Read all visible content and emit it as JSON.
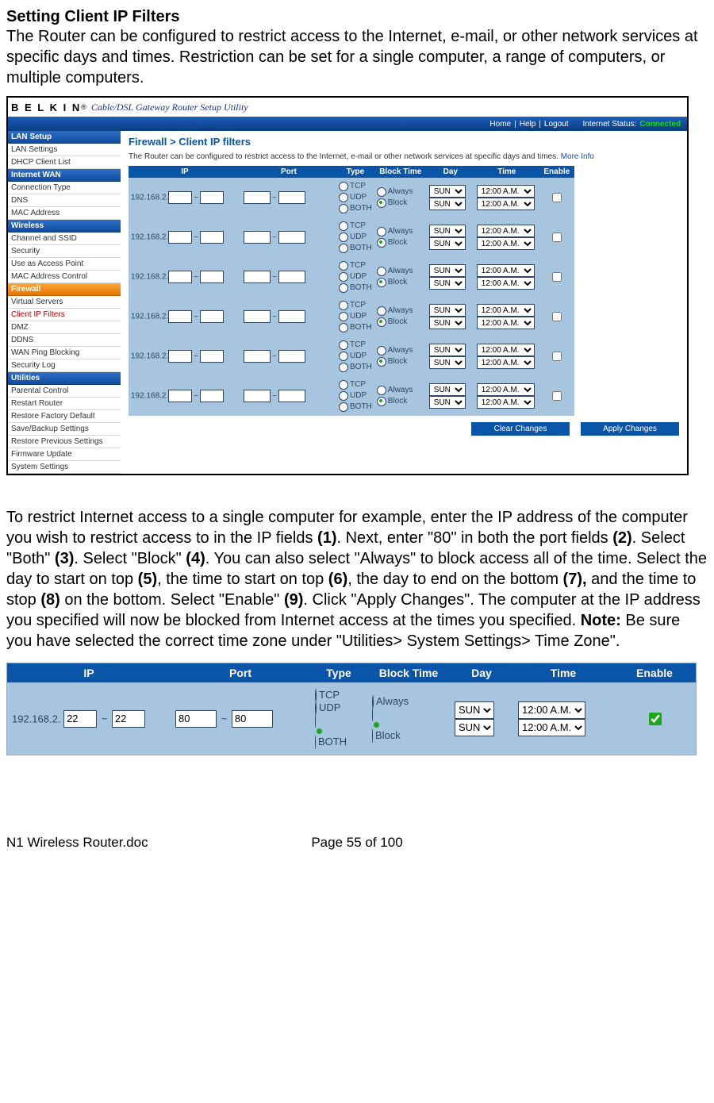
{
  "heading": "Setting Client IP Filters",
  "intro": "The Router can be configured to restrict access to the Internet, e-mail, or other network services at specific days and times. Restriction can be set for a single computer, a range of computers, or multiple computers.",
  "belkin": {
    "logo": "B E L K I N",
    "subtitle": "Cable/DSL Gateway Router Setup Utility"
  },
  "topnav": {
    "home": "Home",
    "help": "Help",
    "logout": "Logout",
    "status_label": "Internet Status:",
    "status_value": "Connected"
  },
  "sidebar": {
    "lan_setup": "LAN Setup",
    "lan_settings": "LAN Settings",
    "dhcp": "DHCP Client List",
    "internet_wan": "Internet WAN",
    "conn_type": "Connection Type",
    "dns": "DNS",
    "mac_addr": "MAC Address",
    "wireless": "Wireless",
    "ch_ssid": "Channel and SSID",
    "security": "Security",
    "use_ap": "Use as Access Point",
    "mac_ctl": "MAC Address Control",
    "firewall": "Firewall",
    "vservers": "Virtual Servers",
    "client_ip": "Client IP Filters",
    "dmz": "DMZ",
    "ddns": "DDNS",
    "wan_ping": "WAN Ping Blocking",
    "sec_log": "Security Log",
    "utilities": "Utilities",
    "parental": "Parental Control",
    "restart": "Restart Router",
    "restore_def": "Restore Factory Default",
    "save_bk": "Save/Backup Settings",
    "restore_prev": "Restore Previous Settings",
    "fw_update": "Firmware Update",
    "sys_set": "System Settings"
  },
  "crumb": {
    "a": "Firewall",
    "sep": " > ",
    "b": "Client IP filters"
  },
  "desc": "The Router can be configured to restrict access to the Internet, e-mail or other network services at specific days and times.",
  "more_info": "More Info",
  "th": {
    "ip": "IP",
    "port": "Port",
    "type": "Type",
    "block": "Block Time",
    "day": "Day",
    "time": "Time",
    "enable": "Enable"
  },
  "row": {
    "ip_prefix": "192.168.2.",
    "tcp": "TCP",
    "udp": "UDP",
    "both": "BOTH",
    "always": "Always",
    "block": "Block",
    "day_opt": "SUN",
    "time_opt": "12:00 A.M."
  },
  "buttons": {
    "clear": "Clear Changes",
    "apply": "Apply Changes"
  },
  "para2_parts": {
    "p1": "To restrict Internet access to a single computer for example, enter the IP address of the computer you wish to restrict access to in the IP fields ",
    "b1": "(1)",
    "p2": ". Next, enter \"80\" in both the port fields ",
    "b2": "(2)",
    "p3": ". Select \"Both\" ",
    "b3": "(3)",
    "p4": ". Select \"Block\" ",
    "b4": "(4)",
    "p5": ". You can also select \"Always\" to block access all of the time. Select the day to start on top ",
    "b5": "(5)",
    "p6": ", the time to start on top ",
    "b6": "(6)",
    "p7": ", the day to end on the bottom ",
    "b7": "(7),",
    "p8": " and the time to stop ",
    "b8": "(8)",
    "p9": " on the bottom. Select \"Enable\" ",
    "b9": "(9)",
    "p10": ". Click \"Apply Changes\". The computer at the IP address you specified will now be blocked from Internet access at the times you specified. ",
    "note": "Note:",
    "p11": " Be sure you have selected the correct time zone under \"Utilities> System Settings> Time Zone\"."
  },
  "big": {
    "ip_prefix": "192.168.2.",
    "ip_a": "22",
    "ip_b": "22",
    "port_a": "80",
    "port_b": "80"
  },
  "footer": {
    "left": "N1 Wireless Router.doc",
    "mid": "Page 55 of 100"
  }
}
